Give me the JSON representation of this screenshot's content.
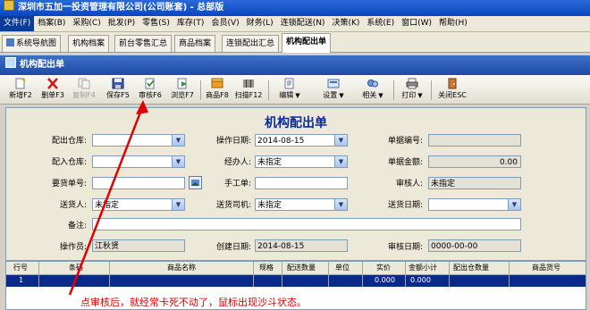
{
  "window": {
    "title": "深圳市五加一投资管理有限公司(公司账套) - 总部版"
  },
  "menu": [
    "文件(F)",
    "档案(B)",
    "采购(C)",
    "批发(P)",
    "零售(S)",
    "库存(T)",
    "会员(V)",
    "财务(L)",
    "连锁配送(N)",
    "决策(K)",
    "系统(E)",
    "窗口(W)",
    "帮助(H)"
  ],
  "tabs": [
    "系统导航图",
    "机构档案",
    "前台零售汇总",
    "商品档案",
    "连锁配出汇总",
    "机构配出单"
  ],
  "panel_title": "机构配出单",
  "toolbar": {
    "new": "新增F2",
    "delete": "删单F3",
    "cancel": "复制F4",
    "save": "保存F5",
    "audit": "审核F6",
    "browse": "浏览F7",
    "goods": "商品F8",
    "scan": "扫描F12",
    "edit": "编辑",
    "settings": "设置",
    "related": "相关",
    "print": "打印",
    "close": "关闭ESC"
  },
  "form": {
    "title": "机构配出单",
    "out_warehouse_label": "配出仓库:",
    "in_warehouse_label": "配入仓库:",
    "request_no_label": "要货单号:",
    "deliverer_label": "送货人:",
    "deliverer_value": "未指定",
    "remark_label": "备注:",
    "operator_label": "操作员:",
    "operator_value": "江秋贤",
    "op_date_label": "操作日期:",
    "op_date_value": "2014-08-15",
    "handler_label": "经办人:",
    "handler_value": "未指定",
    "manual_no_label": "手工单:",
    "driver_label": "送货司机:",
    "driver_value": "未指定",
    "created_label": "创建日期:",
    "created_value": "2014-08-15",
    "doc_no_label": "单据编号:",
    "amount_label": "单据金额:",
    "amount_value": "0.00",
    "auditor_label": "审核人:",
    "auditor_value": "未指定",
    "delivery_date_label": "送货日期:",
    "audit_date_label": "审核日期:",
    "audit_date_value": "0000-00-00"
  },
  "grid": {
    "headers": [
      "行号",
      "条码",
      "商品名称",
      "规格",
      "配送数量",
      "单位",
      "实价",
      "金额小计",
      "配出仓数量",
      "商品货号"
    ],
    "row": {
      "no": "1",
      "price": "0.000",
      "subtotal": "0.000"
    }
  },
  "annotation": "点审核后，就经常卡死不动了，鼠标出现沙斗状态。"
}
